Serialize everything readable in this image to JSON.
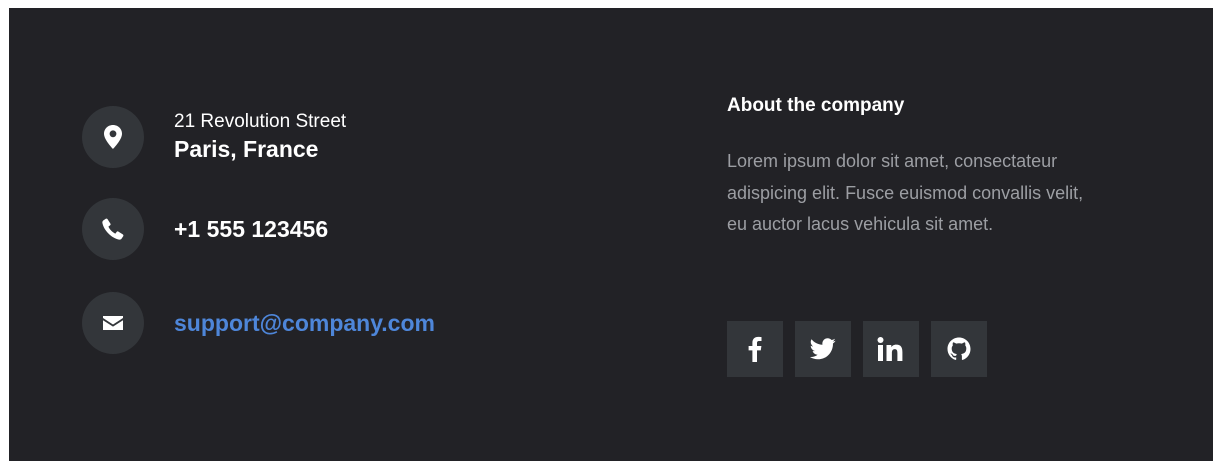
{
  "contact": {
    "address_line1": "21 Revolution Street",
    "address_line2": "Paris, France",
    "phone": "+1 555 123456",
    "email": "support@company.com",
    "icons": [
      "map-pin-icon",
      "phone-icon",
      "envelope-icon"
    ]
  },
  "about": {
    "title": "About the company",
    "text": "Lorem ipsum dolor sit amet, consectateur adispicing elit. Fusce euismod convallis velit, eu auctor lacus vehicula sit amet."
  },
  "social": {
    "links": [
      "facebook-icon",
      "twitter-icon",
      "linkedin-icon",
      "github-icon"
    ]
  },
  "colors": {
    "background": "#222226",
    "icon_background": "#33363a",
    "text": "#ffffff",
    "muted_text": "#9c9ea3",
    "link": "#4e86d9"
  }
}
